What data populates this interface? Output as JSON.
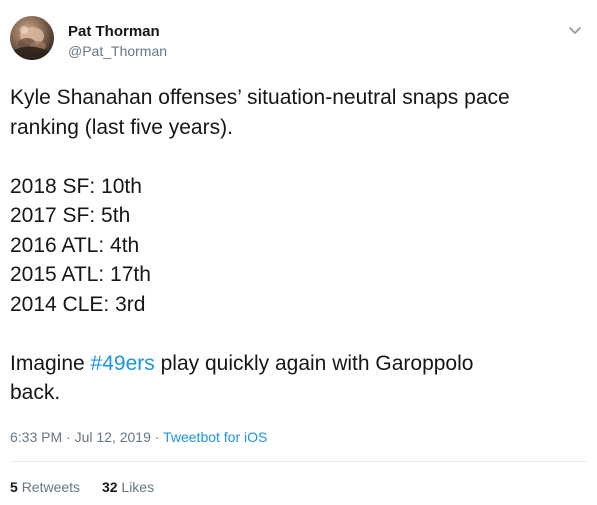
{
  "author": {
    "display_name": "Pat Thorman",
    "handle": "@Pat_Thorman"
  },
  "tweet": {
    "lines_intro": [
      "Kyle Shanahan offenses’ situation-neutral snaps pace",
      "ranking (last five years)."
    ],
    "rankings": [
      "2018 SF: 10th",
      "2017 SF: 5th",
      "2016 ATL: 4th",
      "2015 ATL: 17th",
      "2014 CLE: 3rd"
    ],
    "closing_prefix": "Imagine ",
    "hashtag": "#49ers",
    "closing_suffix_line1": " play quickly again with Garoppolo",
    "closing_line2": "back."
  },
  "meta": {
    "time": "6:33 PM",
    "separator1": " · ",
    "date": "Jul 12, 2019",
    "separator2": " · ",
    "source": "Tweetbot for iOS"
  },
  "stats": {
    "retweets_count": "5",
    "retweets_label": "Retweets",
    "likes_count": "32",
    "likes_label": "Likes"
  },
  "icons": {
    "caret": "chevron-down-icon",
    "avatar": "avatar"
  },
  "colors": {
    "link": "#1b95e0",
    "secondary_text": "#657786",
    "primary_text": "#14171a",
    "divider": "#e6ecf0"
  }
}
